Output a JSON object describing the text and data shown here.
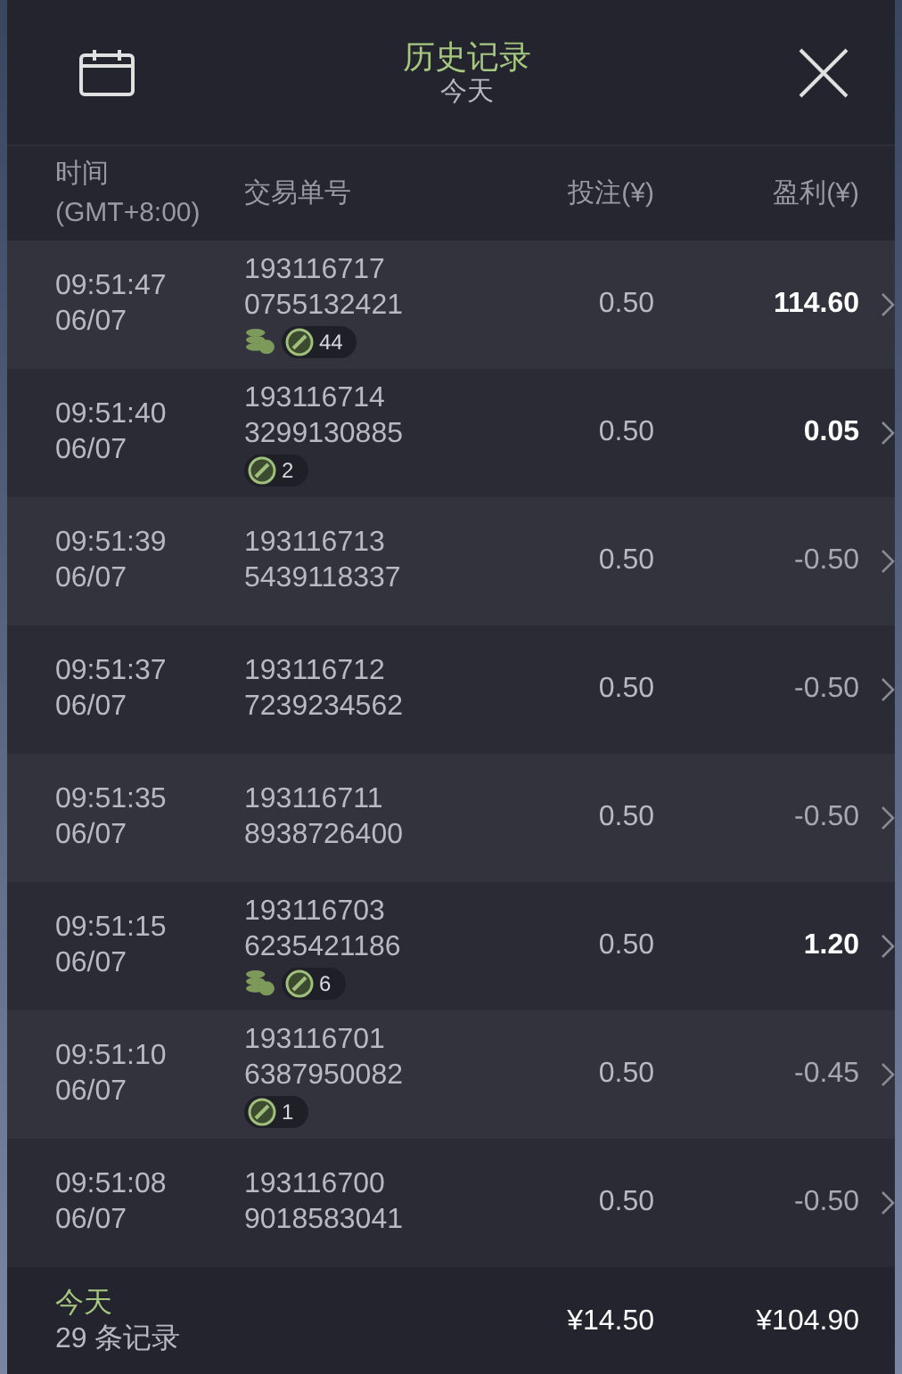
{
  "header": {
    "title": "历史记录",
    "subtitle": "今天"
  },
  "columns": [
    "时间\n(GMT+8:00)",
    "交易单号",
    "投注(¥)",
    "盈利(¥)"
  ],
  "rows": [
    {
      "time": "09:51:47",
      "date": "06/07",
      "order_1": "193116717",
      "order_2": "0755132421",
      "coins": true,
      "count": "44",
      "bet": "0.50",
      "profit": "114.60",
      "win": true
    },
    {
      "time": "09:51:40",
      "date": "06/07",
      "order_1": "193116714",
      "order_2": "3299130885",
      "coins": false,
      "count": "2",
      "bet": "0.50",
      "profit": "0.05",
      "win": true
    },
    {
      "time": "09:51:39",
      "date": "06/07",
      "order_1": "193116713",
      "order_2": "5439118337",
      "coins": false,
      "bet": "0.50",
      "profit": "-0.50",
      "win": false
    },
    {
      "time": "09:51:37",
      "date": "06/07",
      "order_1": "193116712",
      "order_2": "7239234562",
      "coins": false,
      "bet": "0.50",
      "profit": "-0.50",
      "win": false
    },
    {
      "time": "09:51:35",
      "date": "06/07",
      "order_1": "193116711",
      "order_2": "8938726400",
      "coins": false,
      "bet": "0.50",
      "profit": "-0.50",
      "win": false
    },
    {
      "time": "09:51:15",
      "date": "06/07",
      "order_1": "193116703",
      "order_2": "6235421186",
      "coins": true,
      "count": "6",
      "bet": "0.50",
      "profit": "1.20",
      "win": true
    },
    {
      "time": "09:51:10",
      "date": "06/07",
      "order_1": "193116701",
      "order_2": "6387950082",
      "coins": false,
      "count": "1",
      "bet": "0.50",
      "profit": "-0.45",
      "win": false
    },
    {
      "time": "09:51:08",
      "date": "06/07",
      "order_1": "193116700",
      "order_2": "9018583041",
      "coins": false,
      "bet": "0.50",
      "profit": "-0.50",
      "win": false
    }
  ],
  "footer": {
    "period": "今天",
    "records": "29 条记录",
    "total_bet": "¥14.50",
    "total_profit": "¥104.90"
  }
}
